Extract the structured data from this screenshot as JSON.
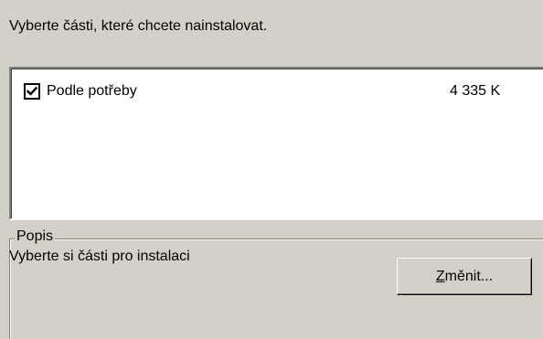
{
  "instruction": "Vyberte části, které chcete nainstalovat.",
  "components": [
    {
      "label": "Podle potřeby",
      "size": "4 335 K",
      "checked": true
    }
  ],
  "description_group": {
    "title": "Popis",
    "text": "Vyberte si části pro instalaci"
  },
  "change_button": {
    "accel_char": "Z",
    "rest_label": "měnit..."
  }
}
